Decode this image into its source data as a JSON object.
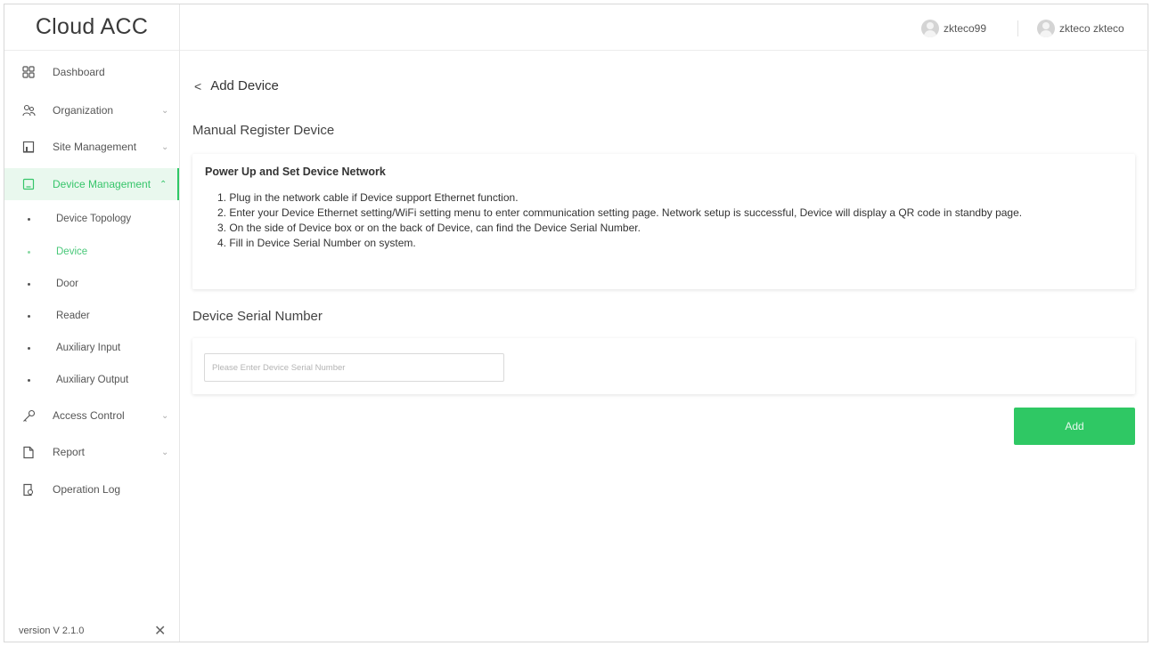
{
  "app": {
    "title": "Cloud ACC"
  },
  "header": {
    "user1": "zkteco99",
    "user2": "zkteco zkteco"
  },
  "sidebar": {
    "items": [
      {
        "label": "Dashboard",
        "icon": "dashboard-grid-icon"
      },
      {
        "label": "Organization",
        "icon": "organization-icon"
      },
      {
        "label": "Site Management",
        "icon": "site-icon"
      },
      {
        "label": "Device Management",
        "icon": "device-icon"
      },
      {
        "label": "Access Control",
        "icon": "key-icon"
      },
      {
        "label": "Report",
        "icon": "file-icon"
      },
      {
        "label": "Operation Log",
        "icon": "log-icon"
      }
    ],
    "sub_items": [
      {
        "label": "Device Topology"
      },
      {
        "label": "Device"
      },
      {
        "label": "Door"
      },
      {
        "label": "Reader"
      },
      {
        "label": "Auxiliary Input"
      },
      {
        "label": "Auxiliary Output"
      }
    ],
    "version": "version V 2.1.0"
  },
  "main": {
    "back_label": "Add Device",
    "manual_title": "Manual Register Device",
    "network_card": {
      "heading": "Power Up and Set Device Network",
      "steps": [
        "1. Plug in the network cable if Device support Ethernet function.",
        "2. Enter your Device Ethernet setting/WiFi setting menu to enter communication setting page. Network setup is successful, Device will display a QR code in standby page.",
        "3. On the side of Device box or on the back of Device, can find the Device Serial Number.",
        "4. Fill in Device Serial Number on system."
      ]
    },
    "serial_title": "Device Serial Number",
    "serial_placeholder": "Please Enter Device Serial Number",
    "add_button": "Add"
  },
  "colors": {
    "accent": "#2fc864",
    "active_bg": "#e9f8ee"
  }
}
